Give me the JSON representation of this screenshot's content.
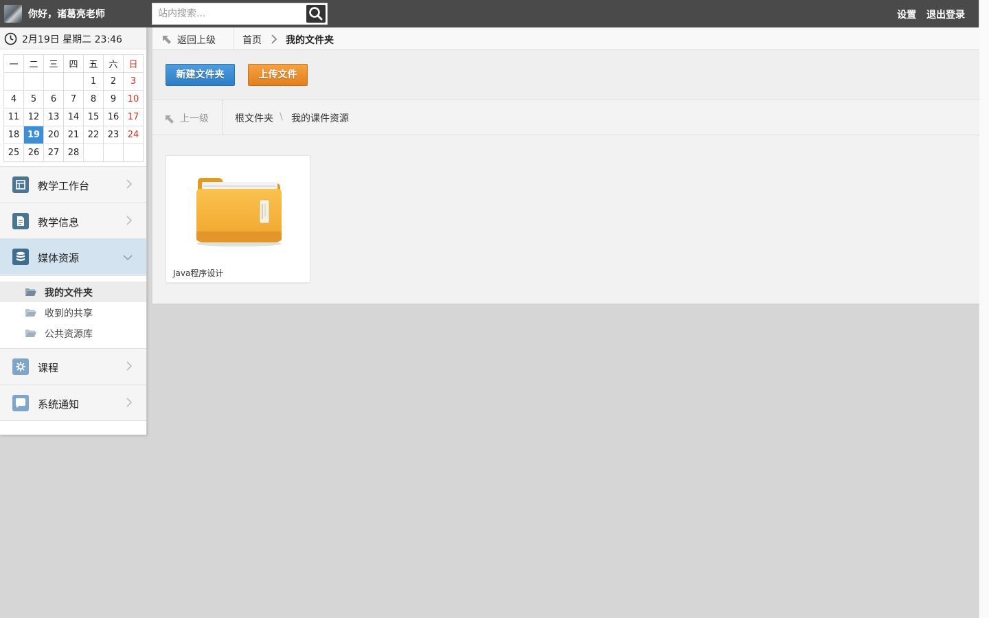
{
  "topbar": {
    "greeting": "你好，诸葛亮老师",
    "search_placeholder": "站内搜索...",
    "settings": "设置",
    "logout": "退出登录"
  },
  "sidebar": {
    "date_text": "2月19日 星期二 23:46",
    "calendar": {
      "weekdays": [
        "一",
        "二",
        "三",
        "四",
        "五",
        "六",
        "日"
      ],
      "weeks": [
        [
          "",
          "",
          "",
          "",
          "1",
          "2",
          "3"
        ],
        [
          "4",
          "5",
          "6",
          "7",
          "8",
          "9",
          "10"
        ],
        [
          "11",
          "12",
          "13",
          "14",
          "15",
          "16",
          "17"
        ],
        [
          "18",
          "19",
          "20",
          "21",
          "22",
          "23",
          "24"
        ],
        [
          "25",
          "26",
          "27",
          "28",
          "",
          "",
          ""
        ]
      ],
      "today": "19"
    },
    "menu": [
      {
        "label": "教学工作台",
        "icon": "dashboard-icon"
      },
      {
        "label": "教学信息",
        "icon": "document-icon"
      },
      {
        "label": "媒体资源",
        "icon": "database-icon"
      },
      {
        "label": "课程",
        "icon": "gear-icon"
      },
      {
        "label": "系统通知",
        "icon": "chat-bubble-icon"
      }
    ],
    "submenu": [
      {
        "label": "我的文件夹"
      },
      {
        "label": "收到的共享"
      },
      {
        "label": "公共资源库"
      }
    ]
  },
  "main": {
    "breadcrumb": {
      "back": "返回上级",
      "home": "首页",
      "current": "我的文件夹"
    },
    "toolbar": {
      "new_folder": "新建文件夹",
      "upload": "上传文件"
    },
    "path": {
      "up": "上一级",
      "root": "根文件夹",
      "separator": "\\",
      "current": "我的课件资源"
    },
    "files": [
      {
        "name": "Java程序设计",
        "type": "folder"
      }
    ]
  },
  "colors": {
    "topbar": "#4a4a4a",
    "accent_blue": "#3b8fd6",
    "accent_orange": "#e3801d",
    "sunday_red": "#d03020"
  }
}
